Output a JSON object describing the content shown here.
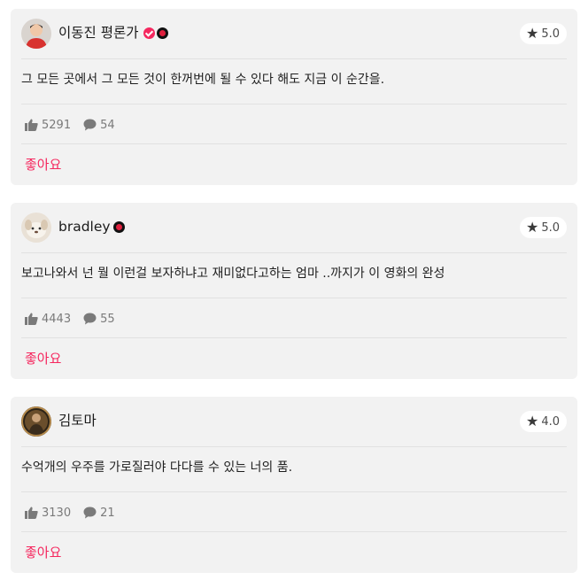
{
  "reviews": [
    {
      "author": "이동진 평론가",
      "verified_badge": true,
      "critic_badge": true,
      "avatar_icon": "avatar-person-red-shirt",
      "rating": "5.0",
      "comment": "그 모든 곳에서 그 모든 것이 한꺼번에 될 수 있다 해도 지금 이 순간을.",
      "likes": "5291",
      "comments": "54",
      "like_action": "좋아요"
    },
    {
      "author": "bradley",
      "verified_badge": false,
      "critic_badge": true,
      "avatar_icon": "avatar-puppy",
      "rating": "5.0",
      "comment": "보고나와서 넌 뭘 이런걸 보자하냐고 재미없다고하는 엄마 ..까지가 이 영화의 완성",
      "likes": "4443",
      "comments": "55",
      "like_action": "좋아요"
    },
    {
      "author": "김토마",
      "verified_badge": false,
      "critic_badge": false,
      "avatar_icon": "avatar-dark-photo",
      "rating": "4.0",
      "comment": "수억개의 우주를 가로질러야 다다를 수 있는 너의 품.",
      "likes": "3130",
      "comments": "21",
      "like_action": "좋아요"
    }
  ],
  "colors": {
    "accent": "#f5285f",
    "card_bg": "#f2f2f2",
    "critic_badge": "#111111"
  },
  "icons": {
    "star": "star-icon",
    "like": "thumbs-up-icon",
    "comment": "comment-bubble-icon"
  }
}
